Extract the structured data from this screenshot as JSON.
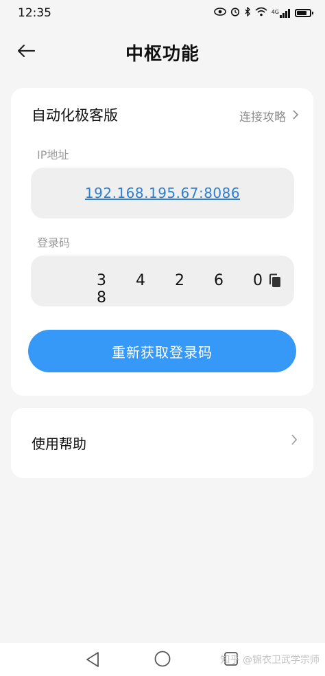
{
  "status_bar": {
    "time": "12:35",
    "signal_label": "4G"
  },
  "header": {
    "title": "中枢功能"
  },
  "device_card": {
    "title": "自动化极客版",
    "guide_link": "连接攻略",
    "ip_label": "IP地址",
    "ip_value": "192.168.195.67:8086",
    "code_label": "登录码",
    "code_value": "3 4 2 6 0 8",
    "refresh_button": "重新获取登录码"
  },
  "help_card": {
    "label": "使用帮助"
  },
  "watermark": "知乎 @锦衣卫武学宗师",
  "colors": {
    "accent": "#3698f7",
    "link": "#2d7fd1",
    "background": "#f5f5f5"
  },
  "icons": [
    "back-arrow-icon",
    "chevron-right-icon",
    "copy-icon",
    "nav-back-icon",
    "nav-home-icon",
    "nav-recent-icon"
  ]
}
